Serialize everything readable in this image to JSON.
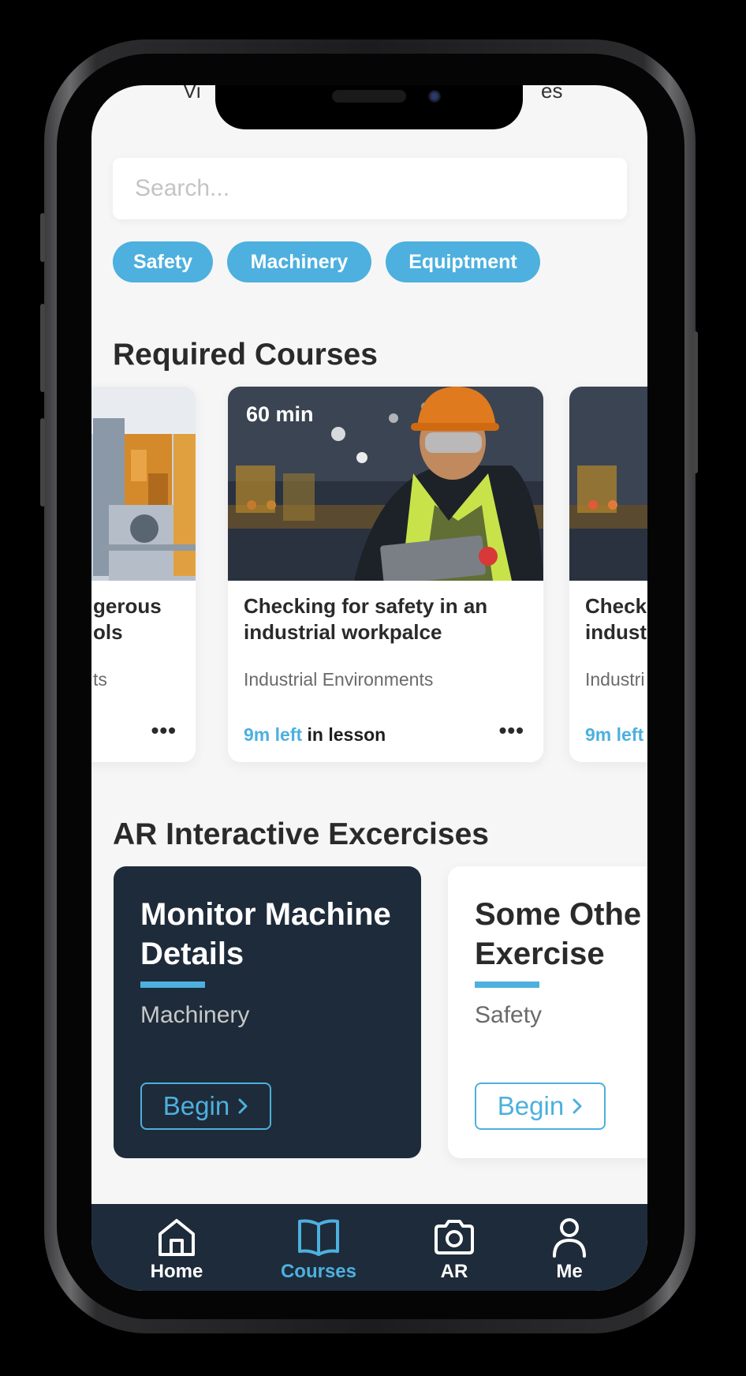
{
  "top_peek": {
    "left": "Vi",
    "right": "es"
  },
  "search": {
    "placeholder": "Search..."
  },
  "filters": [
    "Safety",
    "Machinery",
    "Equiptment"
  ],
  "required_courses": {
    "title": "Required Courses",
    "cards": [
      {
        "title_line1": "gerous",
        "title_line2": "ols",
        "category": "ts",
        "more": "•••"
      },
      {
        "duration": "60 min",
        "title": "Checking for safety in an industrial workpalce",
        "category": "Industrial Environments",
        "time_left": "9m left",
        "time_suffix": " in lesson",
        "more": "•••"
      },
      {
        "title_line1": "Check",
        "title_line2": "indust",
        "category": "Industri",
        "time_left": "9m left"
      }
    ]
  },
  "ar_exercises": {
    "title": "AR Interactive Excercises",
    "cards": [
      {
        "title": "Monitor Machine Details",
        "category": "Machinery",
        "button": "Begin"
      },
      {
        "title_line1": "Some Othe",
        "title_line2": "Exercise",
        "category": "Safety",
        "button": "Begin"
      }
    ]
  },
  "nav": {
    "items": [
      {
        "label": "Home",
        "icon": "home-icon",
        "active": false
      },
      {
        "label": "Courses",
        "icon": "book-icon",
        "active": true
      },
      {
        "label": "AR",
        "icon": "camera-icon",
        "active": false
      },
      {
        "label": "Me",
        "icon": "user-icon",
        "active": false
      }
    ],
    "active_color": "#4db0de",
    "inactive_color": "#ffffff"
  },
  "colors": {
    "accent": "#4db0de",
    "dark": "#1e2b3a",
    "background": "#f6f6f7"
  }
}
